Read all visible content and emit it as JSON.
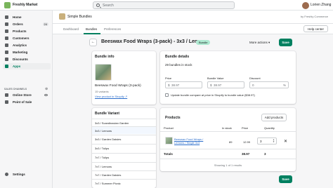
{
  "topbar": {
    "store_name": "Freshly Market",
    "search_placeholder": "Search",
    "user_name": "Lorien Zhang"
  },
  "sidebar": {
    "items": [
      {
        "label": "Home"
      },
      {
        "label": "Orders",
        "badge": "24"
      },
      {
        "label": "Products"
      },
      {
        "label": "Customers"
      },
      {
        "label": "Analytics"
      },
      {
        "label": "Marketing"
      },
      {
        "label": "Discounts"
      },
      {
        "label": "Apps",
        "active": true
      }
    ],
    "sales_channels_title": "SALES CHANNELS",
    "channels": [
      {
        "label": "Online Store"
      },
      {
        "label": "Point of Sale"
      }
    ],
    "settings_label": "Settings"
  },
  "app": {
    "title": "Simple Bundles",
    "by": "by Freshly Commerce",
    "tabs": [
      {
        "label": "Dashboard"
      },
      {
        "label": "Bundles",
        "active": true
      },
      {
        "label": "Preferences"
      }
    ],
    "help_label": "Help center"
  },
  "page": {
    "title": "Beeswax Food Wraps (3-pack) - 3x3 / Lemons",
    "badge": "Bundle",
    "more_actions": "More actions",
    "save_label": "Save"
  },
  "bundle_info": {
    "title": "Bundle info",
    "name": "Beeswax Food Wraps (3-pack)",
    "variants": "15 variants",
    "view_link": "View product in Shopify ↗"
  },
  "bundle_variant": {
    "title": "Bundle Variant",
    "items": [
      {
        "label": "3x3 / Scandinavian Garden"
      },
      {
        "label": "3x3 / Lemons",
        "active": true
      },
      {
        "label": "3x3 / Garden Daisies"
      },
      {
        "label": "3x3 / Tulips"
      },
      {
        "label": "7x7 / Tulips"
      },
      {
        "label": "7x7 / Lemons"
      },
      {
        "label": "7x7 / Garden Daisies"
      },
      {
        "label": "7x7 / Summer Picnic"
      }
    ]
  },
  "bundle_details": {
    "title": "Bundle details",
    "stock": "29 bundles in stock",
    "price_label": "Price",
    "price_value": "38.97",
    "bundle_value_label": "Bundle Value",
    "bundle_value": "38.97",
    "discount_label": "Discount",
    "discount_value": "0",
    "currency": "$",
    "percent": "%",
    "checkbox_label": "Update bundle compare at price in Shopify to bundle value ($38.97)"
  },
  "products": {
    "title": "Products",
    "add_label": "Add products",
    "columns": [
      "Product",
      "In stock",
      "Price",
      "Quantity"
    ],
    "rows": [
      {
        "name": "Beeswax Food Wraps / Lemons / Single 3x3",
        "in_stock": "89",
        "price": "12.99",
        "quantity": "3"
      }
    ],
    "total_label": "Totals",
    "total_price": "38.97",
    "total_qty": "3",
    "showing": "Showing 1 of 1 results"
  }
}
